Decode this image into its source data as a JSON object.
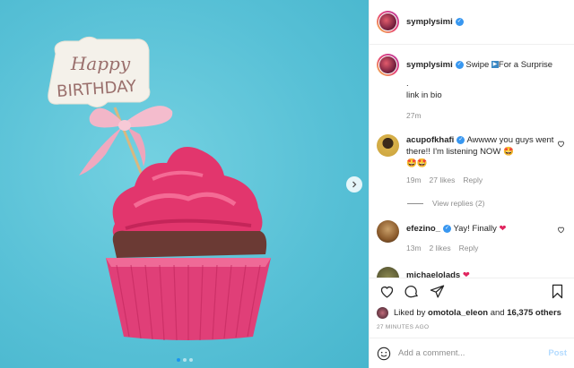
{
  "post": {
    "username": "symplysimi",
    "caption": {
      "prefix": "Swipe",
      "suffix": "For a Surprise",
      "dot": ".",
      "link": "link in bio",
      "time": "27m"
    },
    "card": {
      "line1": "Happy",
      "line2": "BIRTHDAY"
    },
    "carousel": {
      "slides": 3,
      "active": 0
    }
  },
  "comments": [
    {
      "username": "acupofkhafi",
      "text": "Awwww you guys went there!! I'm listening NOW",
      "emoji_line": "🤩🤩",
      "emoji_inline": "🤩",
      "time": "19m",
      "likes": "27 likes",
      "reply": "Reply",
      "view_replies": "View replies (2)",
      "avatar_color": "#c9a23c"
    },
    {
      "username": "efezino_",
      "text": "Yay! Finally",
      "time": "13m",
      "likes": "2 likes",
      "reply": "Reply",
      "avatar_color": "#8a5a2b"
    },
    {
      "username": "michaelolads",
      "text": "",
      "avatar_color": "#6a6a3a"
    }
  ],
  "liked_by": {
    "prefix": "Liked by",
    "user": "omotola_eleon",
    "and": "and",
    "count": "16,375 others"
  },
  "timestamp": "27 MINUTES AGO",
  "add_comment": {
    "placeholder": "Add a comment...",
    "post_label": "Post"
  },
  "colors": {
    "accent": "#3897f0",
    "heart": "#ed4956",
    "frosting": "#e2366d",
    "wrapper": "#e03f78",
    "sky": "#5ac4d8"
  }
}
